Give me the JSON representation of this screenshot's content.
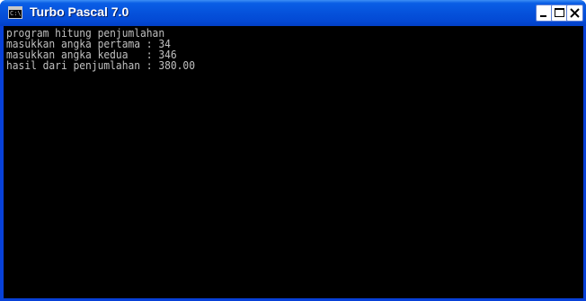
{
  "window": {
    "title": "Turbo Pascal 7.0",
    "icon": "console-app-icon",
    "icon_label": "C:\\.",
    "controls": [
      "minimize",
      "maximize",
      "close"
    ]
  },
  "console": {
    "lines": [
      "program hitung penjumlahan",
      "masukkan angka pertama : 34",
      "masukkan angka kedua   : 346",
      "hasil dari penjumlahan : 380.00"
    ],
    "background": "#000000",
    "foreground": "#c0c0c0"
  },
  "colors": {
    "titlebar": "#0653dc",
    "frame": "#0841d8"
  }
}
